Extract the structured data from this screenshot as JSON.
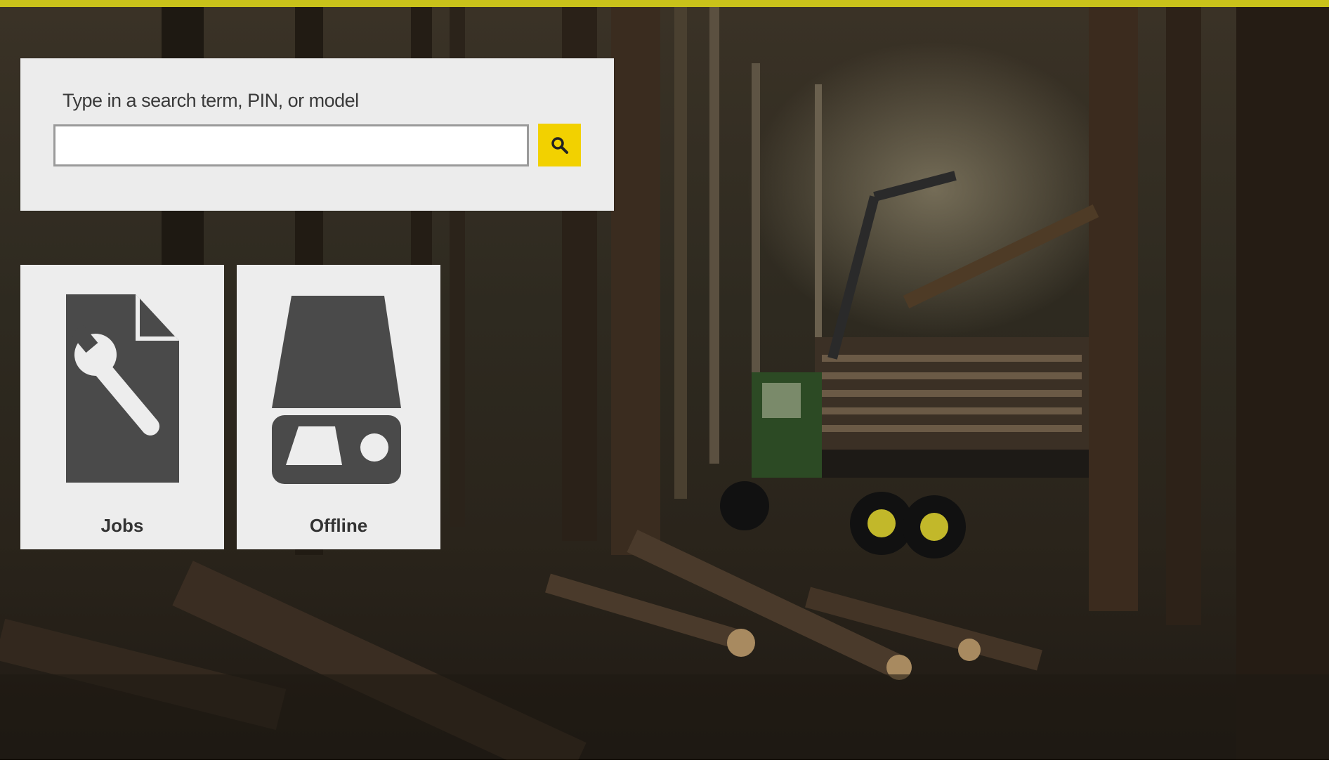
{
  "search": {
    "label": "Type in a search term, PIN, or model",
    "value": "",
    "button_icon": "search-icon"
  },
  "tiles": [
    {
      "label": "Jobs",
      "icon": "document-wrench-icon"
    },
    {
      "label": "Offline",
      "icon": "drive-eject-icon"
    }
  ],
  "colors": {
    "accent_yellow": "#f2d100",
    "top_bar": "#c9c21a",
    "panel_bg": "#ececec",
    "icon_dark": "#4a4a4a"
  }
}
